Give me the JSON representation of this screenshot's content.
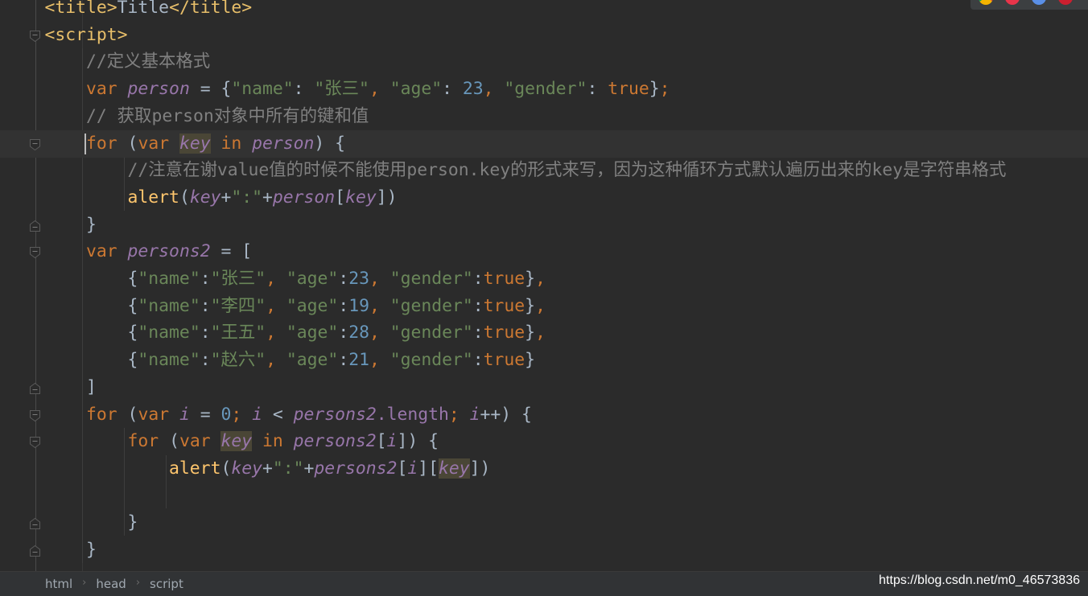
{
  "editor": {
    "current_line": 5,
    "lines": [
      [
        [
          "tag",
          "    <title>"
        ],
        [
          "",
          "Title"
        ],
        [
          "tag",
          "</title>"
        ]
      ],
      [
        [
          "tag",
          "    <script>"
        ]
      ],
      [
        [
          "cm",
          "        //定义基本格式"
        ]
      ],
      [
        [
          "kw",
          "        var "
        ],
        [
          "var",
          "person"
        ],
        [
          "",
          " = {"
        ],
        [
          "str",
          "\"name\""
        ],
        [
          "",
          ": "
        ],
        [
          "str",
          "\"张三\""
        ],
        [
          "kw",
          ", "
        ],
        [
          "str",
          "\"age\""
        ],
        [
          "",
          ": "
        ],
        [
          "num",
          "23"
        ],
        [
          "kw",
          ", "
        ],
        [
          "str",
          "\"gender\""
        ],
        [
          "",
          ": "
        ],
        [
          "kw",
          "true"
        ],
        [
          "",
          "}"
        ],
        [
          "kw",
          ";"
        ]
      ],
      [
        [
          "cm",
          "        // 获取person对象中所有的键和值"
        ]
      ],
      [
        [
          "",
          "        "
        ],
        [
          "caret",
          ""
        ],
        [
          "kw",
          "for "
        ],
        [
          "",
          "("
        ],
        [
          "kw",
          "var "
        ],
        [
          "varhl",
          "key"
        ],
        [
          "kw",
          " in "
        ],
        [
          "var",
          "person"
        ],
        [
          "",
          ") {"
        ]
      ],
      [
        [
          "cm",
          "            //注意在谢value值的时候不能使用person.key的形式来写，因为这种循环方式默认遍历出来的key是字符串格式"
        ]
      ],
      [
        [
          "fn",
          "            alert"
        ],
        [
          "",
          "("
        ],
        [
          "var",
          "key"
        ],
        [
          "",
          "+"
        ],
        [
          "str",
          "\":\""
        ],
        [
          "",
          "+"
        ],
        [
          "var",
          "person"
        ],
        [
          "",
          "["
        ],
        [
          "var",
          "key"
        ],
        [
          "",
          "])"
        ]
      ],
      [
        [
          "",
          "        }"
        ]
      ],
      [
        [
          "kw",
          "        var "
        ],
        [
          "var",
          "persons2"
        ],
        [
          "",
          " = ["
        ]
      ],
      [
        [
          "",
          "            {"
        ],
        [
          "str",
          "\"name\""
        ],
        [
          "",
          ":"
        ],
        [
          "str",
          "\"张三\""
        ],
        [
          "kw",
          ", "
        ],
        [
          "str",
          "\"age\""
        ],
        [
          "",
          ":"
        ],
        [
          "num",
          "23"
        ],
        [
          "kw",
          ", "
        ],
        [
          "str",
          "\"gender\""
        ],
        [
          "",
          ":"
        ],
        [
          "kw",
          "true"
        ],
        [
          "",
          "}"
        ],
        [
          "kw",
          ","
        ]
      ],
      [
        [
          "",
          "            {"
        ],
        [
          "str",
          "\"name\""
        ],
        [
          "",
          ":"
        ],
        [
          "str",
          "\"李四\""
        ],
        [
          "kw",
          ", "
        ],
        [
          "str",
          "\"age\""
        ],
        [
          "",
          ":"
        ],
        [
          "num",
          "19"
        ],
        [
          "kw",
          ", "
        ],
        [
          "str",
          "\"gender\""
        ],
        [
          "",
          ":"
        ],
        [
          "kw",
          "true"
        ],
        [
          "",
          "}"
        ],
        [
          "kw",
          ","
        ]
      ],
      [
        [
          "",
          "            {"
        ],
        [
          "str",
          "\"name\""
        ],
        [
          "",
          ":"
        ],
        [
          "str",
          "\"王五\""
        ],
        [
          "kw",
          ", "
        ],
        [
          "str",
          "\"age\""
        ],
        [
          "",
          ":"
        ],
        [
          "num",
          "28"
        ],
        [
          "kw",
          ", "
        ],
        [
          "str",
          "\"gender\""
        ],
        [
          "",
          ":"
        ],
        [
          "kw",
          "true"
        ],
        [
          "",
          "}"
        ],
        [
          "kw",
          ","
        ]
      ],
      [
        [
          "",
          "            {"
        ],
        [
          "str",
          "\"name\""
        ],
        [
          "",
          ":"
        ],
        [
          "str",
          "\"赵六\""
        ],
        [
          "kw",
          ", "
        ],
        [
          "str",
          "\"age\""
        ],
        [
          "",
          ":"
        ],
        [
          "num",
          "21"
        ],
        [
          "kw",
          ", "
        ],
        [
          "str",
          "\"gender\""
        ],
        [
          "",
          ":"
        ],
        [
          "kw",
          "true"
        ],
        [
          "",
          "}"
        ]
      ],
      [
        [
          "",
          "        ]"
        ]
      ],
      [
        [
          "kw",
          "        for "
        ],
        [
          "",
          "("
        ],
        [
          "kw",
          "var "
        ],
        [
          "var",
          "i"
        ],
        [
          "",
          " = "
        ],
        [
          "num",
          "0"
        ],
        [
          "kw",
          "; "
        ],
        [
          "var",
          "i"
        ],
        [
          "",
          " < "
        ],
        [
          "var",
          "persons2"
        ],
        [
          "prop",
          ".length"
        ],
        [
          "kw",
          "; "
        ],
        [
          "var",
          "i"
        ],
        [
          "",
          "++) {"
        ]
      ],
      [
        [
          "kw",
          "            for "
        ],
        [
          "",
          "("
        ],
        [
          "kw",
          "var "
        ],
        [
          "varhl",
          "key"
        ],
        [
          "kw",
          " in "
        ],
        [
          "var",
          "persons2"
        ],
        [
          "",
          "["
        ],
        [
          "var",
          "i"
        ],
        [
          "",
          "]) {"
        ]
      ],
      [
        [
          "fn",
          "                alert"
        ],
        [
          "",
          "("
        ],
        [
          "var",
          "key"
        ],
        [
          "",
          "+"
        ],
        [
          "str",
          "\":\""
        ],
        [
          "",
          "+"
        ],
        [
          "var",
          "persons2"
        ],
        [
          "",
          "["
        ],
        [
          "var",
          "i"
        ],
        [
          "",
          "]["
        ],
        [
          "varhl",
          "key"
        ],
        [
          "",
          "])"
        ]
      ],
      [],
      [
        [
          "",
          "            }"
        ]
      ],
      [
        [
          "",
          "        }"
        ]
      ]
    ],
    "folds": [
      {
        "line": 1,
        "dir": "open"
      },
      {
        "line": 5,
        "dir": "open"
      },
      {
        "line": 8,
        "dir": "close"
      },
      {
        "line": 9,
        "dir": "open"
      },
      {
        "line": 14,
        "dir": "close"
      },
      {
        "line": 15,
        "dir": "open"
      },
      {
        "line": 16,
        "dir": "open"
      },
      {
        "line": 19,
        "dir": "close"
      },
      {
        "line": 20,
        "dir": "close"
      }
    ]
  },
  "breadcrumb": [
    "html",
    "head",
    "script"
  ],
  "watermark": "https://blog.csdn.net/m0_46573836",
  "browser_icons": [
    "chrome-icon",
    "firefox-icon",
    "chromium-icon",
    "opera-icon"
  ],
  "colors": {
    "background": "#2b2b2b",
    "keyword": "#cc7832",
    "variable": "#9876aa",
    "string": "#6a8759",
    "number": "#6897bb",
    "comment": "#808080",
    "function": "#ffc66d",
    "tag": "#e8bf6a"
  }
}
